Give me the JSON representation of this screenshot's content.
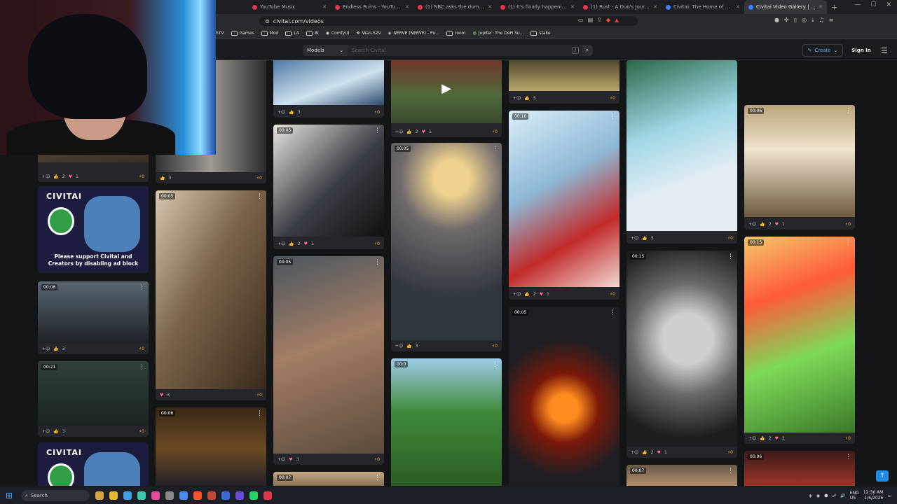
{
  "browser": {
    "tabs": [
      {
        "title": "YouTube Music",
        "active": false
      },
      {
        "title": "Endless Ruins - YouTube Music",
        "active": false
      },
      {
        "title": "(1) NBC asks the dumbest questio...",
        "active": false
      },
      {
        "title": "(1) It's finally happening in Iran...",
        "active": false
      },
      {
        "title": "(1) Rust - A Duo's Journey: The Ri...",
        "active": false
      },
      {
        "title": "Civitai: The Home of Open-Source...",
        "active": false
      },
      {
        "title": "Civitai Video Gallery | AI-Gene...",
        "active": true
      }
    ],
    "url": "civitai.com/videos",
    "bookmarks": [
      "hTV",
      "Games",
      "Mod",
      "LA",
      "AI",
      "ComfyUI",
      "Wan-S2V",
      "NERVE (NERVE) - Pu...",
      "room",
      "Jupiter: The DeFi Su...",
      "stake"
    ]
  },
  "site": {
    "models_label": "Models",
    "search_placeholder": "Search Civitai",
    "shortcut_key": "/",
    "create_label": "Create",
    "signin_label": "Sign In"
  },
  "ad": {
    "logo": "CIVITAI",
    "text": "Please support Civitai and Creators by disabling ad block"
  },
  "cards": [
    {
      "id": "c1",
      "duration": "",
      "likes": "2",
      "hearts": "1",
      "buzz": "0"
    },
    {
      "id": "c2",
      "duration": "00:06",
      "likes": "3",
      "hearts": "",
      "buzz": "0"
    },
    {
      "id": "c3",
      "duration": "00:21",
      "likes": "3",
      "hearts": "",
      "buzz": "0"
    },
    {
      "id": "c4",
      "duration": "",
      "likes": "3",
      "hearts": "",
      "buzz": "0"
    },
    {
      "id": "c5",
      "duration": "00:05",
      "likes": "",
      "hearts": "3",
      "buzz": "0"
    },
    {
      "id": "c6",
      "duration": "00:06",
      "likes": "",
      "hearts": "",
      "buzz": ""
    },
    {
      "id": "c7",
      "duration": "",
      "likes": "3",
      "hearts": "",
      "buzz": "0"
    },
    {
      "id": "c8",
      "duration": "00:05",
      "likes": "2",
      "hearts": "1",
      "buzz": "0"
    },
    {
      "id": "c9",
      "duration": "00:05",
      "likes": "",
      "hearts": "3",
      "buzz": "0"
    },
    {
      "id": "c10",
      "duration": "00:07",
      "likes": "",
      "hearts": "",
      "buzz": ""
    },
    {
      "id": "c11",
      "duration": "",
      "likes": "2",
      "hearts": "1",
      "buzz": "0"
    },
    {
      "id": "c12",
      "duration": "00:05",
      "likes": "3",
      "hearts": "",
      "buzz": "0"
    },
    {
      "id": "c13",
      "duration": "00:0",
      "likes": "",
      "hearts": "",
      "buzz": ""
    },
    {
      "id": "c14",
      "duration": "",
      "likes": "3",
      "hearts": "",
      "buzz": "0"
    },
    {
      "id": "c15",
      "duration": "00:10",
      "likes": "2",
      "hearts": "1",
      "buzz": "0"
    },
    {
      "id": "c16",
      "duration": "00:05",
      "likes": "",
      "hearts": "",
      "buzz": ""
    },
    {
      "id": "c17",
      "duration": "",
      "likes": "3",
      "hearts": "",
      "buzz": "0"
    },
    {
      "id": "c18",
      "duration": "00:15",
      "likes": "2",
      "hearts": "1",
      "buzz": "0"
    },
    {
      "id": "c19",
      "duration": "00:07",
      "likes": "",
      "hearts": "",
      "buzz": ""
    },
    {
      "id": "c20",
      "duration": "00:06",
      "likes": "2",
      "hearts": "1",
      "buzz": "0"
    },
    {
      "id": "c21",
      "duration": "00:15",
      "likes": "2",
      "hearts": "2",
      "buzz": "0"
    },
    {
      "id": "c22",
      "duration": "00:06",
      "likes": "",
      "hearts": "",
      "buzz": ""
    }
  ],
  "taskbar": {
    "search_label": "Search",
    "lang": "ENG\nUS",
    "time": "12:36 AM",
    "date": "1/6/2026"
  }
}
